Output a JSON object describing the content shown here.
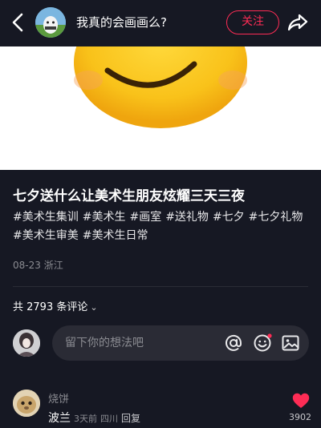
{
  "header": {
    "author_name": "我真的会画画么?",
    "follow_label": "关注"
  },
  "post": {
    "title": "七夕送什么让美术生朋友炫耀三天三夜",
    "tags": [
      "#美术生集训",
      "#美术生",
      "#画室",
      "#送礼物",
      "#七夕",
      "#七夕礼物",
      "#美术生审美",
      "#美术生日常"
    ],
    "date": "08-23",
    "location": "浙江"
  },
  "comments_section": {
    "count_label": "共 2793 条评论",
    "input_placeholder": "留下你的想法吧"
  },
  "comment": {
    "author": "烧饼",
    "text": "波兰",
    "time": "3天前",
    "location": "四川",
    "reply_label": "回复",
    "likes": "3902"
  },
  "colors": {
    "background": "#161823",
    "accent": "#fe2c55"
  },
  "icons": [
    "back-arrow-icon",
    "share-icon",
    "at-icon",
    "emoji-icon",
    "image-icon",
    "heart-icon",
    "chevron-down-icon"
  ]
}
